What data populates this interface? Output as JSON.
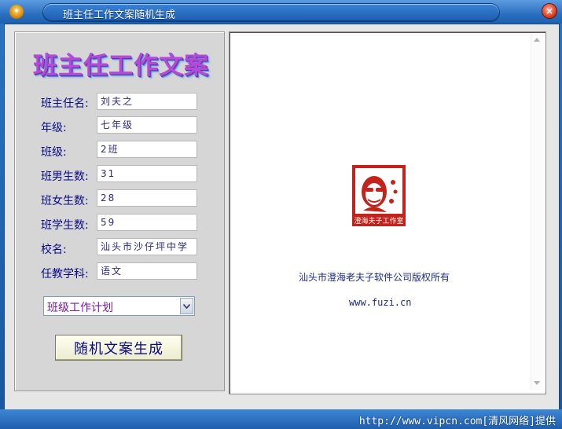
{
  "window": {
    "title": "班主任工作文案随机生成"
  },
  "form": {
    "heading": "班主任工作文案",
    "fields": [
      {
        "label": "班主任名:",
        "value": "刘夫之"
      },
      {
        "label": "年级:",
        "value": "七年级"
      },
      {
        "label": "班级:",
        "value": "2班"
      },
      {
        "label": "班男生数:",
        "value": "31"
      },
      {
        "label": "班女生数:",
        "value": "28"
      },
      {
        "label": "班学生数:",
        "value": "59"
      },
      {
        "label": "校名:",
        "value": "汕头市沙仔坪中学"
      },
      {
        "label": "任教学科:",
        "value": "语文"
      }
    ],
    "type_select": {
      "value": "班级工作计划"
    },
    "generate_button": "随机文案生成"
  },
  "preview": {
    "seal_text": "澄海夫子工作室",
    "copyright": "汕头市澄海老夫子软件公司版权所有",
    "website": "www.fuzi.cn"
  },
  "watermark": "http://www.vipcn.com[清风网络]提供",
  "colors": {
    "title_bar": "#2b6fc0",
    "label_text": "#0a0a8a",
    "heading": "#b44bd6",
    "seal_red": "#c4231b"
  }
}
